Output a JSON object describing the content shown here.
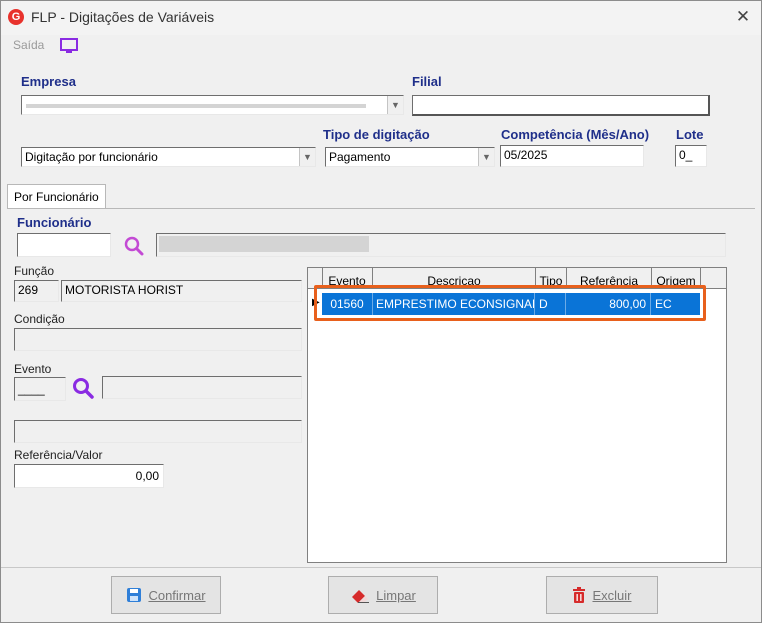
{
  "window": {
    "logo_letter": "G",
    "title": "FLP - Digitações de Variáveis",
    "close_glyph": "✕"
  },
  "toolbar": {
    "saida_label": "Saída"
  },
  "empresa": {
    "label": "Empresa",
    "value": ""
  },
  "filial": {
    "label": "Filial",
    "value": ""
  },
  "digitacao_mode": {
    "value": "Digitação por funcionário"
  },
  "tipo_digitacao": {
    "label": "Tipo de digitação",
    "value": "Pagamento"
  },
  "competencia": {
    "label": "Competência (Mês/Ano)",
    "value": "05/2025"
  },
  "lote": {
    "label": "Lote",
    "value": "0_"
  },
  "tabs": {
    "por_funcionario": "Por Funcionário"
  },
  "funcionario": {
    "label": "Funcionário",
    "value": "",
    "name": ""
  },
  "funcao": {
    "label": "Função",
    "code": "269",
    "name": "MOTORISTA HORIST"
  },
  "condicao": {
    "label": "Condição",
    "value": ""
  },
  "evento": {
    "label": "Evento",
    "code": "____",
    "name": "",
    "extra": ""
  },
  "referencia_valor": {
    "label": "Referência/Valor",
    "value": "0,00"
  },
  "grid": {
    "headers": {
      "evento": "Evento",
      "descricao": "Descricao",
      "tipo": "Tipo",
      "referencia": "Referência",
      "origem": "Origem"
    },
    "rows": [
      {
        "evento": "01560",
        "descricao": "EMPRESTIMO ECONSIGNADO",
        "tipo": "D",
        "referencia": "800,00",
        "origem": "EC"
      }
    ]
  },
  "buttons": {
    "confirmar": "Confirmar",
    "limpar": "Limpar",
    "excluir": "Excluir"
  },
  "colors": {
    "highlight": "#e8601c",
    "selection": "#0a74d7",
    "label_blue": "#1f2f8a",
    "search_purple": "#8a2be2"
  }
}
